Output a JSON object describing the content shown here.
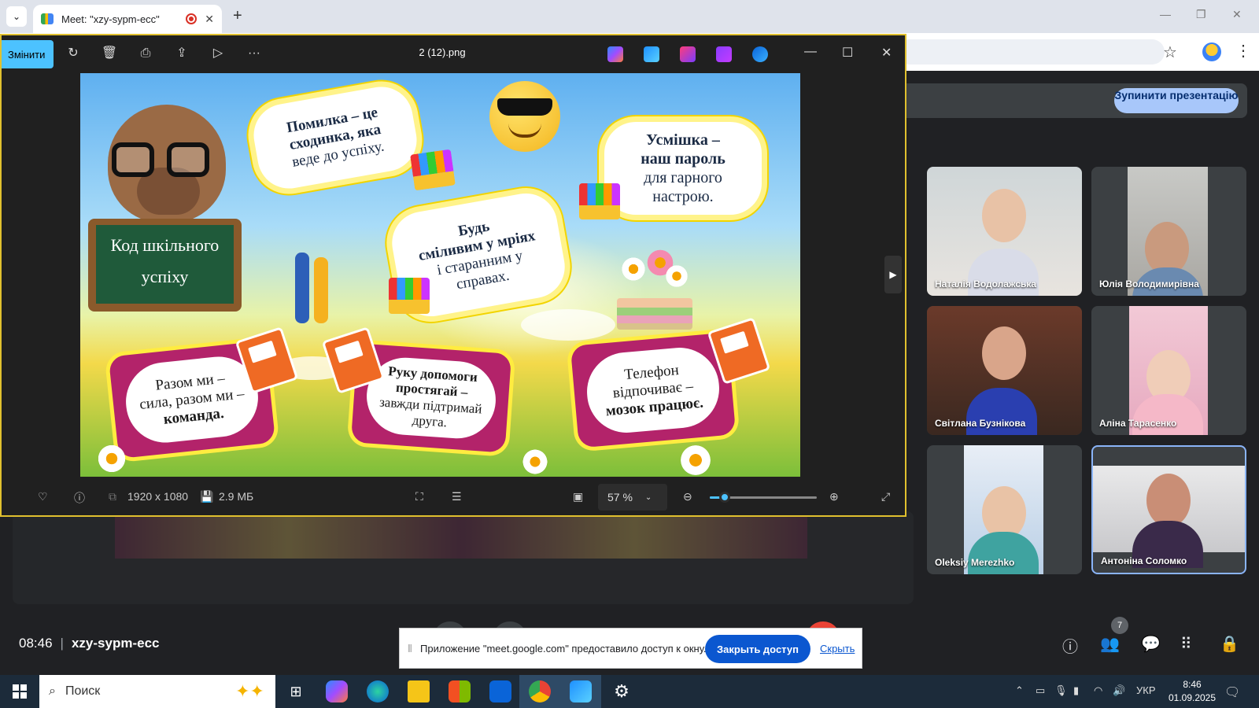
{
  "browser": {
    "tab_title": "Meet: \"xzy-sypm-ecc\"",
    "new_tab": "+",
    "tab_close": "✕"
  },
  "meet": {
    "stop_presentation": "Зупинити презентацію",
    "time": "08:46",
    "meeting_code": "xzy-sypm-ecc",
    "people_count": "7",
    "participants": [
      {
        "name": "Наталія Водолажська"
      },
      {
        "name": "Юлія Володимирівна"
      },
      {
        "name": "Світлана Бузнікова"
      },
      {
        "name": "Аліна Тарасенко"
      },
      {
        "name": "Oleksiy Merezhko"
      },
      {
        "name": "Антоніна Соломко"
      }
    ],
    "share_notice": {
      "message": "Приложение \"meet.google.com\" предоставило доступ к окну.",
      "deny_label": "Закрыть доступ",
      "hide_label": "Скрыть"
    }
  },
  "viewer": {
    "edit_label": "Змінити",
    "file_name": "2 (12).png",
    "dimensions": "1920 x 1080",
    "file_size": "2.9 МБ",
    "zoom_label": "57 %",
    "zoom_fraction": 0.14
  },
  "poster": {
    "board_line1": "Код шкільного",
    "board_line2": "успіху",
    "bubble1": [
      "Помилка – це",
      "сходинка, яка",
      "веде до успіху."
    ],
    "bubble2": [
      "Будь",
      "сміливим у мріях",
      "і старанним у",
      "справах."
    ],
    "bubble3": [
      "Усмішка –",
      "наш пароль",
      "для гарного",
      "настрою."
    ],
    "box1": [
      "Разом ми –",
      "сила, разом ми –",
      "команда."
    ],
    "box2": [
      "Руку допомоги",
      "простягай –",
      "завжди підтримай",
      "друга."
    ],
    "box3": [
      "Телефон",
      "відпочиває –",
      "мозок працює."
    ]
  },
  "taskbar": {
    "search_placeholder": "Поиск",
    "language": "УКР",
    "clock_time": "8:46",
    "clock_date": "01.09.2025"
  }
}
